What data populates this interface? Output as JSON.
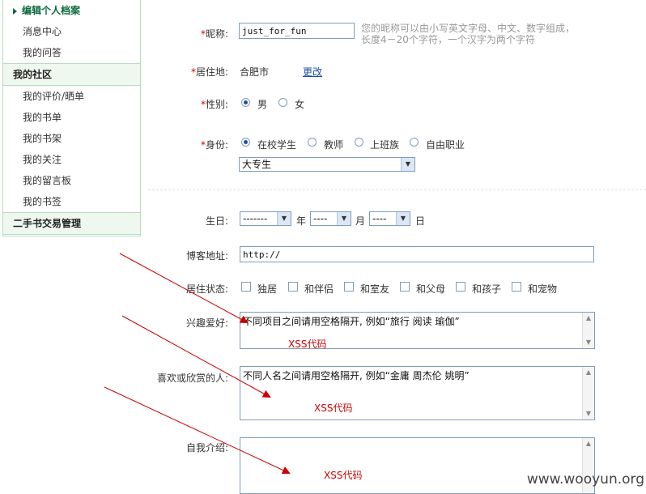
{
  "sidebar": {
    "items": [
      {
        "label": "编辑个人档案"
      },
      {
        "label": "消息中心"
      },
      {
        "label": "我的问答"
      }
    ],
    "section1": "我的社区",
    "community": [
      {
        "label": "我的评价/晒单"
      },
      {
        "label": "我的书单"
      },
      {
        "label": "我的书架"
      },
      {
        "label": "我的关注"
      },
      {
        "label": "我的留言板"
      },
      {
        "label": "我的书签"
      }
    ],
    "section2": "二手书交易管理"
  },
  "form": {
    "nickname": {
      "label": "昵称:",
      "value": "just_for_fun",
      "hint1": "您的昵称可以由小写英文字母、中文、数字组成，",
      "hint2": "长度4－20个字符，一个汉字为两个字符"
    },
    "residence": {
      "label": "居住地:",
      "value": "合肥市",
      "link": "更改"
    },
    "gender": {
      "label": "性别:",
      "options": [
        "男",
        "女"
      ],
      "selected": "男"
    },
    "identity": {
      "label": "身份:",
      "options": [
        "在校学生",
        "教师",
        "上班族",
        "自由职业"
      ],
      "selected": "在校学生",
      "education": "大专生"
    },
    "birthday": {
      "label": "生日:",
      "year": "-------",
      "year_unit": "年",
      "month": "----",
      "month_unit": "月",
      "day": "----",
      "day_unit": "日"
    },
    "blog": {
      "label": "博客地址:",
      "value": "http://"
    },
    "living": {
      "label": "居住状态:",
      "options": [
        "独居",
        "和伴侣",
        "和室友",
        "和父母",
        "和孩子",
        "和宠物"
      ]
    },
    "hobbies": {
      "label": "兴趣爱好:",
      "placeholder": "不同项目之间请用空格隔开, 例如“旅行 阅读 瑜伽”",
      "annotation": "XSS代码"
    },
    "favorites": {
      "label": "喜欢或欣赏的人:",
      "placeholder": "不同人名之间请用空格隔开, 例如“金庸 周杰伦 姚明”",
      "annotation": "XSS代码"
    },
    "intro": {
      "label": "自我介绍:",
      "annotation": "XSS代码"
    }
  },
  "watermark": "www.wooyun.org",
  "colors": {
    "required": "#d40000",
    "annotation": "#cc0000",
    "arrow": "#cc0000",
    "sidebar_border": "#b7dcc1",
    "active": "#0c6a3c"
  }
}
